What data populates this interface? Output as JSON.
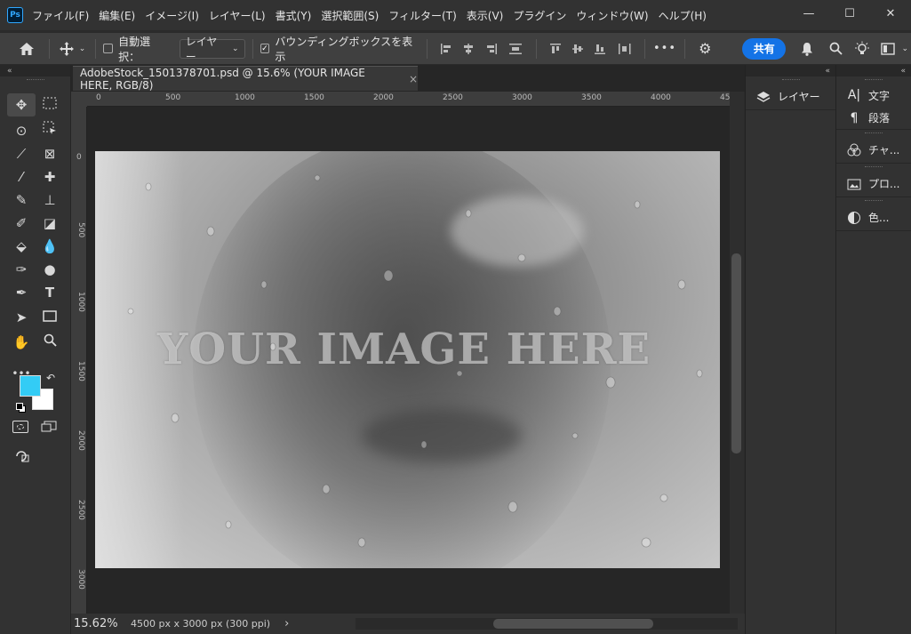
{
  "app": {
    "logo": "Ps"
  },
  "menu": [
    "ファイル(F)",
    "編集(E)",
    "イメージ(I)",
    "レイヤー(L)",
    "書式(Y)",
    "選択範囲(S)",
    "フィルター(T)",
    "表示(V)",
    "プラグイン",
    "ウィンドウ(W)",
    "ヘルプ(H)"
  ],
  "window": {
    "minimize": "—",
    "maximize": "☐",
    "close": "✕"
  },
  "options": {
    "auto_select_label": "自動選択：",
    "layer_select": "レイヤー",
    "bounding_box_label": "バウンディングボックスを表示",
    "more": "•••",
    "share_label": "共有"
  },
  "document": {
    "tab_title": "AdobeStock_1501378701.psd @ 15.6% (YOUR IMAGE HERE, RGB/8)",
    "tab_close": "×",
    "overlay_text": "YOUR IMAGE HERE"
  },
  "ruler": {
    "h_labels": [
      "0",
      "500",
      "1000",
      "1500",
      "2000",
      "2500",
      "3000",
      "3500",
      "4000",
      "45"
    ],
    "v_labels": [
      "0",
      "500",
      "1000",
      "1500",
      "2000",
      "2500",
      "3000"
    ]
  },
  "status": {
    "zoom": "15.62%",
    "doc_info": "4500 px x 3000 px (300 ppi)",
    "arrow": "›"
  },
  "panels": {
    "layers_label": "レイヤー",
    "type_label": "文字",
    "paragraph_label": "段落",
    "channels_label": "チャ...",
    "properties_label": "プロ...",
    "color_label": "色..."
  },
  "colors": {
    "foreground": "#33ccf5",
    "background": "#ffffff",
    "accent": "#1473e6"
  }
}
